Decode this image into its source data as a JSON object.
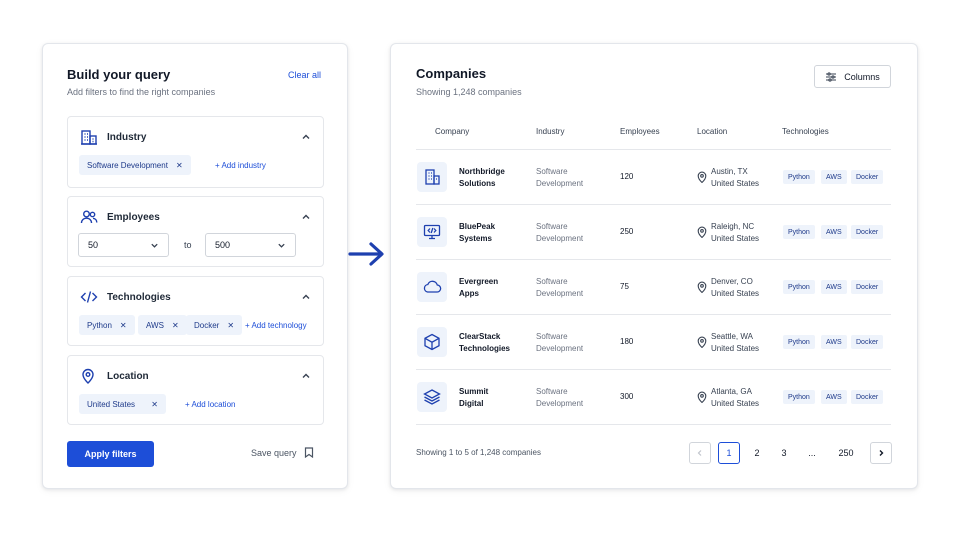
{
  "query_builder": {
    "title": "Build your query",
    "subtitle": "Add filters to find the right companies",
    "clear_all": "Clear all",
    "industry": {
      "label": "Industry",
      "chips": [
        "Software Development"
      ],
      "add_label": "+ Add industry"
    },
    "employees": {
      "label": "Employees",
      "min": "50",
      "to_label": "to",
      "max": "500"
    },
    "technologies": {
      "label": "Technologies",
      "chips": [
        "Python",
        "AWS",
        "Docker"
      ],
      "add_label": "+ Add technology"
    },
    "location": {
      "label": "Location",
      "chips": [
        "United States"
      ],
      "add_label": "+ Add location"
    },
    "apply_label": "Apply filters",
    "save_label": "Save query"
  },
  "companies": {
    "title": "Companies",
    "subtitle": "Showing 1,248 companies",
    "columns_label": "Columns",
    "headers": [
      "Company",
      "Industry",
      "Employees",
      "Location",
      "Technologies"
    ],
    "rows": [
      {
        "name_1": "Northbridge",
        "name_2": "Solutions",
        "industry_1": "Software",
        "industry_2": "Development",
        "employees": "120",
        "city": "Austin, TX",
        "country": "United States",
        "tags": [
          "Python",
          "AWS",
          "Docker"
        ],
        "icon": "building-icon"
      },
      {
        "name_1": "BluePeak",
        "name_2": "Systems",
        "industry_1": "Software",
        "industry_2": "Development",
        "employees": "250",
        "city": "Raleigh, NC",
        "country": "United States",
        "tags": [
          "Python",
          "AWS",
          "Docker"
        ],
        "icon": "monitor-code-icon"
      },
      {
        "name_1": "Evergreen",
        "name_2": "Apps",
        "industry_1": "Software",
        "industry_2": "Development",
        "employees": "75",
        "city": "Denver, CO",
        "country": "United States",
        "tags": [
          "Python",
          "AWS",
          "Docker"
        ],
        "icon": "cloud-icon"
      },
      {
        "name_1": "ClearStack",
        "name_2": "Technologies",
        "industry_1": "Software",
        "industry_2": "Development",
        "employees": "180",
        "city": "Seattle, WA",
        "country": "United States",
        "tags": [
          "Python",
          "AWS",
          "Docker"
        ],
        "icon": "cube-icon"
      },
      {
        "name_1": "Summit",
        "name_2": "Digital",
        "industry_1": "Software",
        "industry_2": "Development",
        "employees": "300",
        "city": "Atlanta, GA",
        "country": "United States",
        "tags": [
          "Python",
          "AWS",
          "Docker"
        ],
        "icon": "layers-icon"
      }
    ],
    "footer_text": "Showing 1 to 5 of 1,248 companies",
    "pages": [
      "1",
      "2",
      "3",
      "...",
      "250"
    ],
    "current_page": "1"
  },
  "colors": {
    "accent": "#1d4ed8",
    "chip_bg": "#eef3fb",
    "arrow": "#1e40af"
  }
}
